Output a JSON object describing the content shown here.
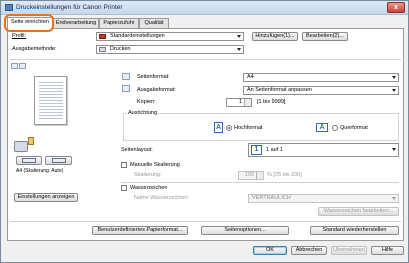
{
  "window": {
    "title": "Druckeinstellungen für Canon Printer",
    "close_glyph": "x"
  },
  "tabs": [
    {
      "label": "Seite einrichten",
      "active": true
    },
    {
      "label": "Endverarbeitung"
    },
    {
      "label": "Papierzufuhr"
    },
    {
      "label": "Qualität"
    }
  ],
  "profile": {
    "label": "Profil:",
    "value": "Standardeinstellungen",
    "add_button": "Hinzufügen(1)...",
    "edit_button": "Bearbeiten(2)..."
  },
  "output_method": {
    "label": "Ausgabemethode:",
    "value": "Drucken"
  },
  "preview": {
    "caption": "A4 (Skalierung: Auto)"
  },
  "page_size": {
    "label": "Seitenformat:",
    "value": "A4"
  },
  "output_size": {
    "label": "Ausgabeformat:",
    "value": "An Seitenformat anpassen"
  },
  "copies": {
    "label": "Kopien:",
    "value": "1",
    "range": "[1 bis 9999]"
  },
  "orientation": {
    "label": "Ausrichtung",
    "portrait": "Hochformat",
    "landscape": "Querformat",
    "selected": "portrait",
    "glyph": "A"
  },
  "page_layout": {
    "label": "Seitenlayout:",
    "value": "1 auf 1",
    "number": "1"
  },
  "manual_scaling": {
    "label": "Manuelle Skalierung",
    "scaling_label": "Skalierung:",
    "scaling_value": "100",
    "scaling_range": "% [25 bis 200]"
  },
  "watermark": {
    "label": "Wasserzeichen",
    "name_label": "Name Wasserzeichen:",
    "name_value": "VERTRAULICH",
    "edit_button": "Wasserzeichen bearbeiten..."
  },
  "buttons": {
    "view_settings": "Einstellungen anzeigen",
    "custom_paper": "Benutzerdefiniertes Papierformat...",
    "page_options": "Seitenoptionen...",
    "restore_defaults": "Standard wiederherstellen",
    "ok": "OK",
    "cancel": "Abbrechen",
    "apply": "Übernehmen",
    "help": "Hilfe"
  },
  "colors": {
    "highlight": "#e8731a",
    "accent": "#1f5fa8"
  }
}
